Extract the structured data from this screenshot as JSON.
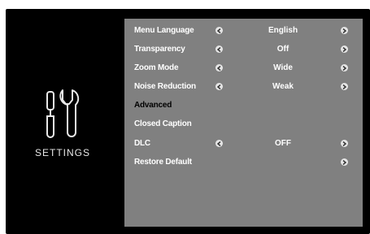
{
  "sidebar": {
    "icon": "tools-icon",
    "title": "SETTINGS"
  },
  "menu": {
    "items": [
      {
        "label": "Menu Language",
        "value": "English"
      },
      {
        "label": "Transparency",
        "value": "Off"
      },
      {
        "label": "Zoom Mode",
        "value": "Wide"
      },
      {
        "label": "Noise Reduction",
        "value": "Weak"
      },
      {
        "label": "Advanced"
      },
      {
        "label": "Closed Caption"
      },
      {
        "label": "DLC",
        "value": "OFF"
      },
      {
        "label": "Restore Default"
      }
    ]
  },
  "colors": {
    "screen_bg": "#000000",
    "panel_bg": "#808080",
    "text": "#ffffff",
    "arrow": "#e6e6e6"
  }
}
